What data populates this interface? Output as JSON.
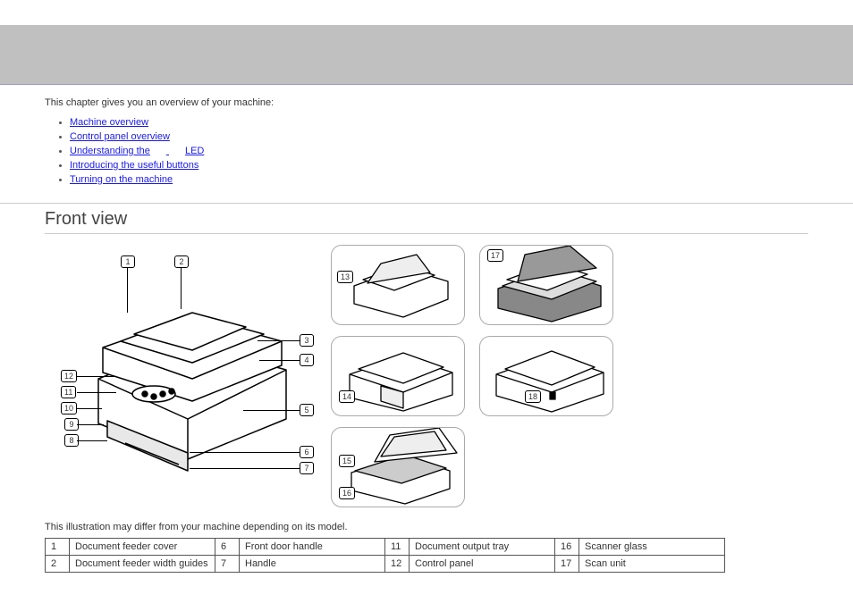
{
  "intro": "This chapter gives you an overview of your machine:",
  "toc": {
    "item1": "Machine overview",
    "item2": "Control panel overview",
    "item3a": "Understanding the",
    "item3b": "LED",
    "item4": "Introducing the useful buttons",
    "item5": "Turning on the machine"
  },
  "subheading": "Front view",
  "note": "This illustration may differ from your machine depending on its model.",
  "callouts": {
    "c1": "1",
    "c2": "2",
    "c3": "3",
    "c4": "4",
    "c5": "5",
    "c6": "6",
    "c7": "7",
    "c8": "8",
    "c9": "9",
    "c10": "10",
    "c11": "11",
    "c12": "12",
    "c13": "13",
    "c14": "14",
    "c15": "15",
    "c16": "16",
    "c17": "17",
    "c18": "18"
  },
  "parts": {
    "r1": {
      "n1": "1",
      "l1": "Document feeder cover",
      "n2": "6",
      "l2": "Front door handle",
      "n3": "11",
      "l3": "Document output tray",
      "n4": "16",
      "l4": "Scanner glass"
    },
    "r2": {
      "n1": "2",
      "l1": "Document feeder width guides",
      "n2": "7",
      "l2": "Handle",
      "n3": "12",
      "l3": "Control panel",
      "n4": "17",
      "l4": "Scan unit"
    }
  }
}
